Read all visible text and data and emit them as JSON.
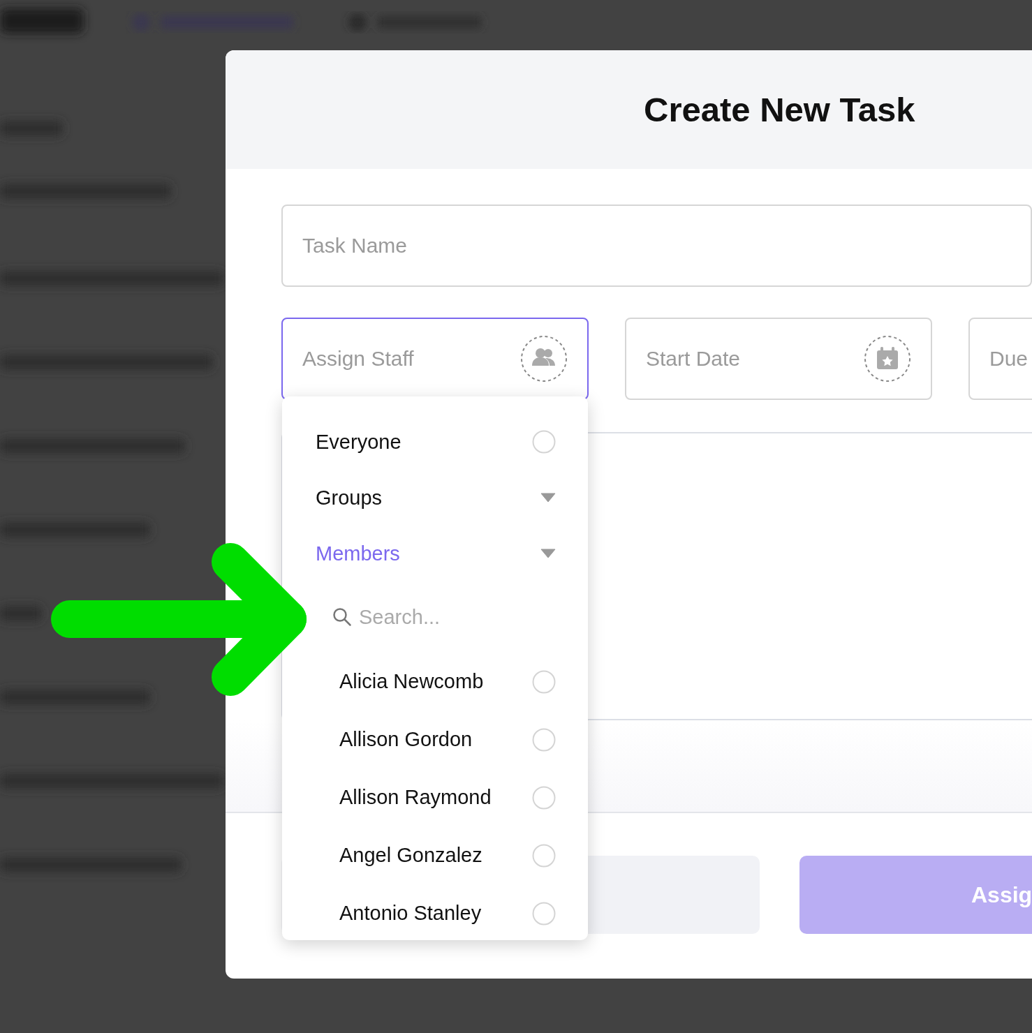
{
  "modal": {
    "title": "Create New Task",
    "task_name": {
      "placeholder": "Task Name"
    },
    "assign_staff": {
      "placeholder": "Assign Staff",
      "focused": true
    },
    "start_date": {
      "placeholder": "Start Date"
    },
    "due_date": {
      "placeholder": "Due"
    },
    "buttons": [
      {
        "kind": "secondary"
      },
      {
        "kind": "primary",
        "label": "Assig"
      }
    ]
  },
  "dropdown": {
    "options": [
      {
        "kind": "radio",
        "label": "Everyone",
        "selected": false
      },
      {
        "kind": "group",
        "label": "Groups",
        "expanded": false
      },
      {
        "kind": "group",
        "label": "Members",
        "expanded": true,
        "search": {
          "placeholder": "Search..."
        },
        "members": [
          {
            "name": "Alicia Newcomb",
            "selected": false
          },
          {
            "name": "Allison Gordon",
            "selected": false
          },
          {
            "name": "Allison Raymond",
            "selected": false
          },
          {
            "name": "Angel Gonzalez",
            "selected": false
          },
          {
            "name": "Antonio Stanley",
            "selected": false
          }
        ]
      }
    ]
  }
}
